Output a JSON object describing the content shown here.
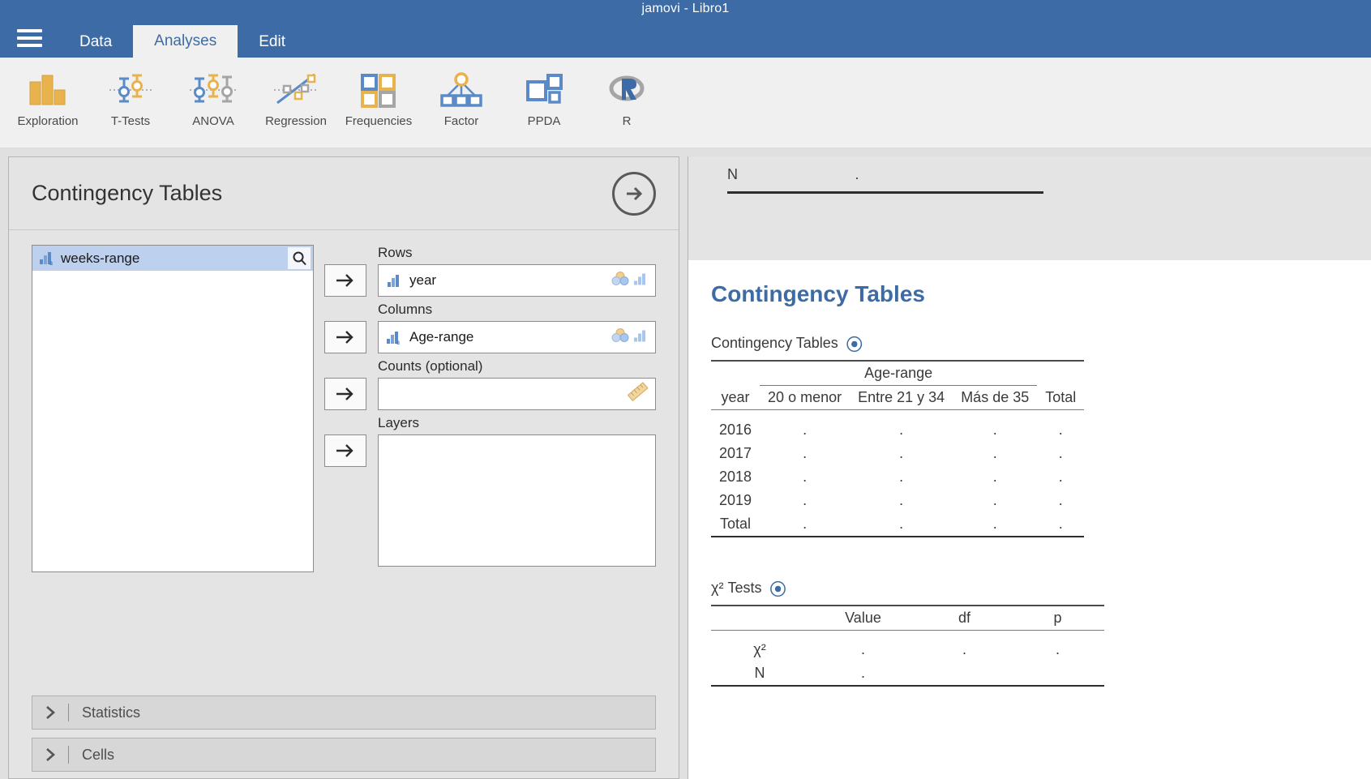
{
  "window": {
    "title": "jamovi - Libro1"
  },
  "menu": {
    "hamburger_icon": "hamburger-menu-icon",
    "tabs": [
      {
        "label": "Data",
        "active": false
      },
      {
        "label": "Analyses",
        "active": true
      },
      {
        "label": "Edit",
        "active": false
      }
    ]
  },
  "ribbon": {
    "items": [
      {
        "label": "Exploration",
        "icon": "bar-chart-icon"
      },
      {
        "label": "T-Tests",
        "icon": "error-bars-two-icon"
      },
      {
        "label": "ANOVA",
        "icon": "error-bars-three-icon"
      },
      {
        "label": "Regression",
        "icon": "scatter-line-icon"
      },
      {
        "label": "Frequencies",
        "icon": "four-squares-icon"
      },
      {
        "label": "Factor",
        "icon": "factor-tree-icon"
      },
      {
        "label": "PPDA",
        "icon": "three-squares-icon"
      },
      {
        "label": "R",
        "icon": "r-logo-icon"
      }
    ]
  },
  "options": {
    "title": "Contingency Tables",
    "hide_button_icon": "arrow-right-circle-icon",
    "variable_list": {
      "search_icon": "search-icon",
      "items": [
        {
          "name": "weeks-range",
          "type_icon": "nominal-text-icon",
          "selected": true
        }
      ]
    },
    "fields": [
      {
        "label": "Rows",
        "transfer_icon": "arrow-right-icon",
        "value": "year",
        "type_icon": "ordinal-icon",
        "permitted_icons": [
          "nominal-icon",
          "ordinal-icon"
        ],
        "tall": false
      },
      {
        "label": "Columns",
        "transfer_icon": "arrow-right-icon",
        "value": "Age-range",
        "type_icon": "nominal-text-icon",
        "permitted_icons": [
          "nominal-icon",
          "ordinal-icon"
        ],
        "tall": false
      },
      {
        "label": "Counts (optional)",
        "transfer_icon": "arrow-right-icon",
        "value": "",
        "type_icon": "",
        "permitted_icons": [
          "continuous-icon"
        ],
        "tall": false
      },
      {
        "label": "Layers",
        "transfer_icon": "arrow-right-icon",
        "value": "",
        "type_icon": "",
        "permitted_icons": [],
        "tall": true
      }
    ],
    "sections": [
      {
        "label": "Statistics",
        "expanded": false,
        "chevron_icon": "chevron-right-icon"
      },
      {
        "label": "Cells",
        "expanded": false,
        "chevron_icon": "chevron-right-icon"
      }
    ]
  },
  "results": {
    "stale_fragment": {
      "row_label": "N",
      "row_value": "."
    },
    "heading": "Contingency Tables",
    "accent_color": "#3d6ba5",
    "tables": [
      {
        "caption": "Contingency Tables",
        "status_icon": "loading-spinner-icon",
        "group_header": {
          "label": "Age-range",
          "span": 3
        },
        "row_header": "year",
        "columns": [
          "20 o menor",
          "Entre 21 y 34",
          "Más de 35",
          "Total"
        ],
        "rows": [
          {
            "label": "2016",
            "values": [
              ".",
              ".",
              ".",
              "."
            ]
          },
          {
            "label": "2017",
            "values": [
              ".",
              ".",
              ".",
              "."
            ]
          },
          {
            "label": "2018",
            "values": [
              ".",
              ".",
              ".",
              "."
            ]
          },
          {
            "label": "2019",
            "values": [
              ".",
              ".",
              ".",
              "."
            ]
          }
        ],
        "total_row": {
          "label": "Total",
          "values": [
            ".",
            ".",
            ".",
            "."
          ]
        }
      },
      {
        "caption": "χ² Tests",
        "status_icon": "loading-spinner-icon",
        "columns": [
          "Value",
          "df",
          "p"
        ],
        "rows": [
          {
            "label": "χ²",
            "values": [
              ".",
              ".",
              "."
            ]
          },
          {
            "label": "N",
            "values": [
              "."
            ]
          }
        ]
      }
    ]
  }
}
